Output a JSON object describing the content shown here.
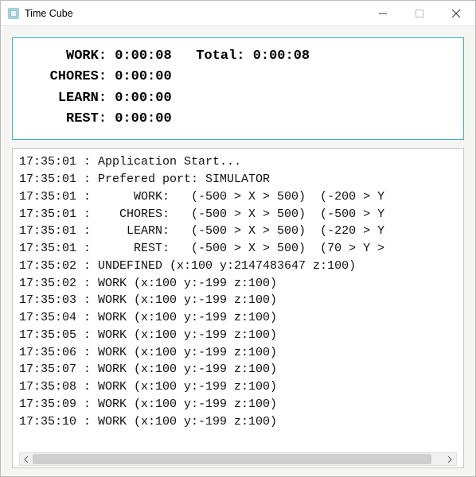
{
  "window": {
    "title": "Time Cube"
  },
  "summary": {
    "work_label": "WORK:",
    "work_value": "0:00:08",
    "total_label": "Total:",
    "total_value": "0:00:08",
    "chores_label": "CHORES:",
    "chores_value": "0:00:00",
    "learn_label": "LEARN:",
    "learn_value": "0:00:00",
    "rest_label": "REST:",
    "rest_value": "0:00:00"
  },
  "log": [
    "17:35:01 : Application Start...",
    "17:35:01 : Prefered port: SIMULATOR",
    "17:35:01 :      WORK:   (-500 > X > 500)  (-200 > Y",
    "17:35:01 :    CHORES:   (-500 > X > 500)  (-500 > Y",
    "17:35:01 :     LEARN:   (-500 > X > 500)  (-220 > Y",
    "17:35:01 :      REST:   (-500 > X > 500)  (70 > Y >",
    "17:35:02 : UNDEFINED (x:100 y:2147483647 z:100)",
    "17:35:02 : WORK (x:100 y:-199 z:100)",
    "17:35:03 : WORK (x:100 y:-199 z:100)",
    "17:35:04 : WORK (x:100 y:-199 z:100)",
    "17:35:05 : WORK (x:100 y:-199 z:100)",
    "17:35:06 : WORK (x:100 y:-199 z:100)",
    "17:35:07 : WORK (x:100 y:-199 z:100)",
    "17:35:08 : WORK (x:100 y:-199 z:100)",
    "17:35:09 : WORK (x:100 y:-199 z:100)",
    "17:35:10 : WORK (x:100 y:-199 z:100)"
  ]
}
